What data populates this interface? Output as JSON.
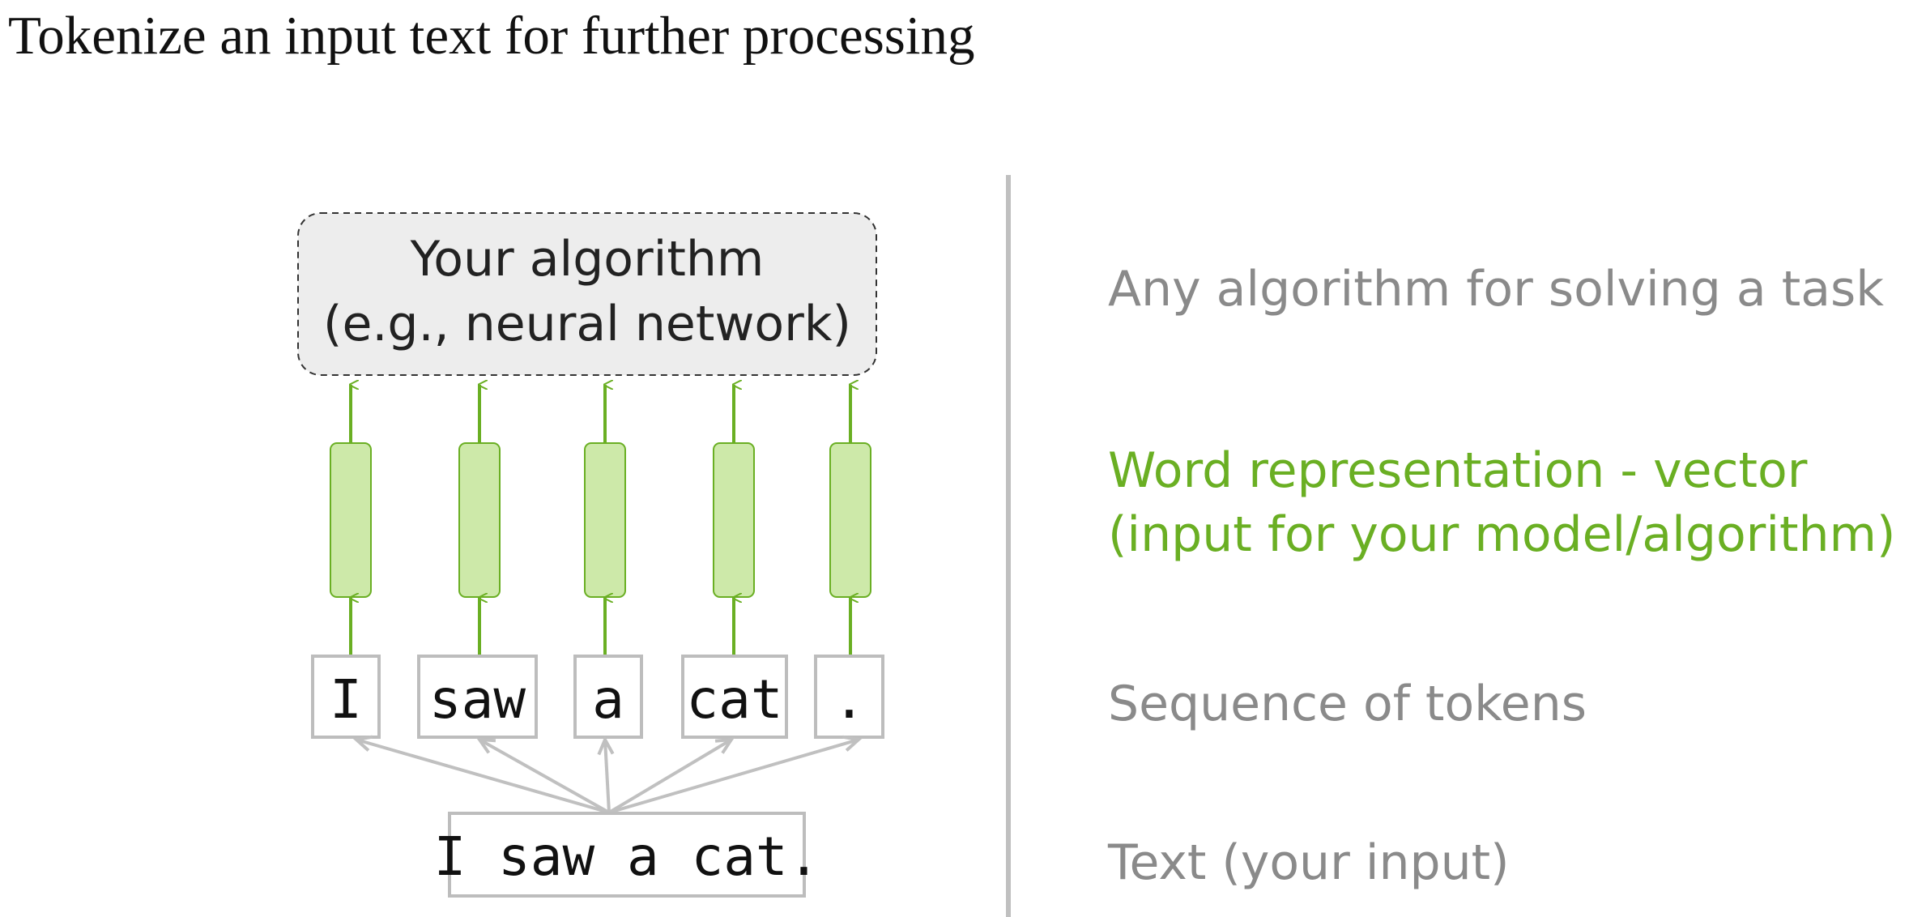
{
  "title": "Tokenize an input text for further processing",
  "algorithm_box": {
    "line1": "Your algorithm",
    "line2": "(e.g., neural network)"
  },
  "tokens": [
    "I",
    "saw",
    "a",
    "cat",
    "."
  ],
  "input_text": "I saw a cat.",
  "labels": {
    "algorithm": "Any algorithm for solving a task",
    "representation_line1": "Word representation - vector",
    "representation_line2": "(input for your model/algorithm)",
    "tokens": "Sequence of tokens",
    "text": "Text (your input)"
  },
  "colors": {
    "green": "#6aaf23",
    "green_fill": "#cde9a9",
    "gray_text": "#8a8a8a",
    "gray_line": "#c0c0c0",
    "box_fill": "#ededed"
  }
}
